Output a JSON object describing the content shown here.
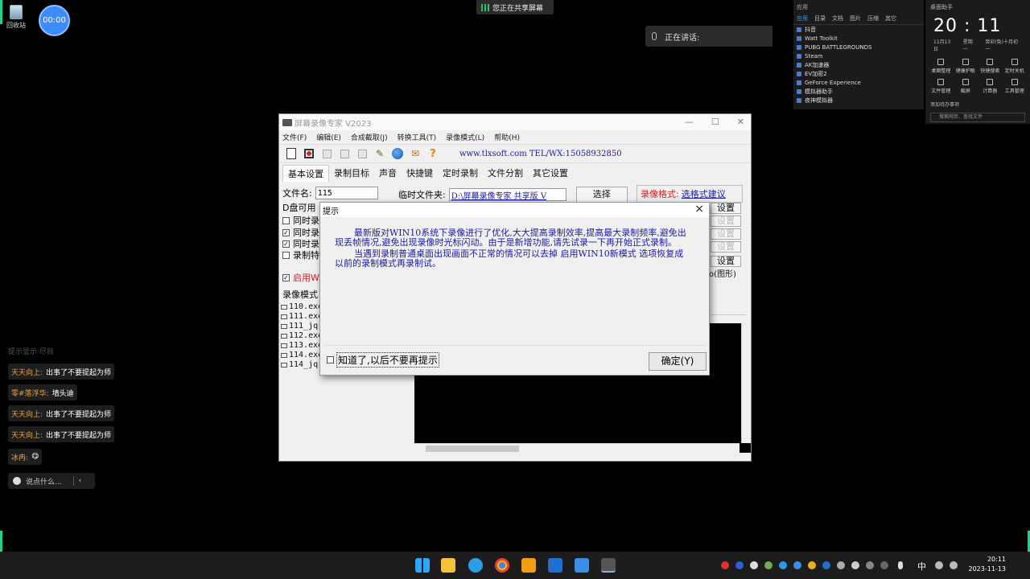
{
  "desktop": {
    "recycle_label": "回收站",
    "timer": "00:00",
    "share_banner": "您正在共享屏幕",
    "speaking_label": "正在讲话:"
  },
  "apps_panel": {
    "title": "应用",
    "tabs": [
      "应用",
      "目录",
      "文档",
      "图片",
      "压缩",
      "其它"
    ],
    "apps": [
      "抖音",
      "Watt Toolkit",
      "PUBG BATTLEGROUNDS",
      "Steam",
      "AK加速器",
      "EV加密2",
      "GeForce Experience",
      "模拟器助手",
      "夜神模拟器"
    ]
  },
  "widget": {
    "title": "桌面助手",
    "clock": "20 : 11",
    "date": "11月13日",
    "weekday": "星期一",
    "lunar": "癸卯(兔)十月初一",
    "tools": [
      "桌面整理",
      "健康护眼",
      "快捷搜索",
      "定时关机",
      "文件管理",
      "截屏",
      "计算器",
      "工具管理"
    ],
    "todo": "添加待办事项",
    "search_placeholder": "搜索网页、查找文件"
  },
  "chat": {
    "faded": "提示显示 尽目",
    "messages": [
      {
        "user": "天天向上:",
        "text": "出事了不要提起为师"
      },
      {
        "user": "零#落浮华:",
        "text": "墙头迪"
      },
      {
        "user": "天天向上:",
        "text": "出事了不要提起为师"
      },
      {
        "user": "天天向上:",
        "text": "出事了不要提起为师"
      },
      {
        "user": "冰冉:",
        "text": "😋"
      }
    ],
    "input_placeholder": "说点什么..."
  },
  "app": {
    "title": "屏幕录像专家 V2023",
    "menu": [
      "文件(F)",
      "编辑(E)",
      "合成截取(J)",
      "转换工具(T)",
      "录像模式(L)",
      "帮助(H)"
    ],
    "website": "www.tlxsoft.com  TEL/WX:15058932850",
    "tabs": [
      "基本设置",
      "录制目标",
      "声音",
      "快捷键",
      "定时录制",
      "文件分割",
      "其它设置"
    ],
    "filename_label": "文件名:",
    "filename_value": "115",
    "tempdir_label": "临时文件夹:",
    "tempdir_value": "D:\\屏幕录像专家 共享版 V",
    "select_button": "选择",
    "format_label": "录像格式:",
    "format_link": "选格式建议",
    "disk_label": "D盘可用",
    "options": [
      {
        "label": "同时录",
        "checked": false
      },
      {
        "label": "同时录",
        "checked": true
      },
      {
        "label": "同时录",
        "checked": true
      },
      {
        "label": "录制特",
        "checked": false
      }
    ],
    "win10_label": "启用WI",
    "settings_button": "设置",
    "graph_label": "o(图形)",
    "mode_label": "录像模式",
    "files": [
      "110.exe",
      "111.exe",
      "111_jq.",
      "112.exe",
      "113.exe",
      "114.exe",
      "114_jq."
    ]
  },
  "dialog": {
    "title": "提示",
    "para1": "最新版对WIN10系统下录像进行了优化,大大提高录制效率,提高最大录制频率,避免出现丢帧情况,避免出现录像时光标闪动。由于是新增功能,请先试录一下再开始正式录制。",
    "para2": "当遇到录制普通桌面出现画面不正常的情况可以去掉 启用WIN10新模式 选项恢复成以前的录制模式再录制试。",
    "dont_show": "知道了,以后不要再提示",
    "ok_button": "确定(Y)"
  },
  "taskbar": {
    "lang": "中",
    "time": "20:11",
    "date": "2023-11-13"
  }
}
